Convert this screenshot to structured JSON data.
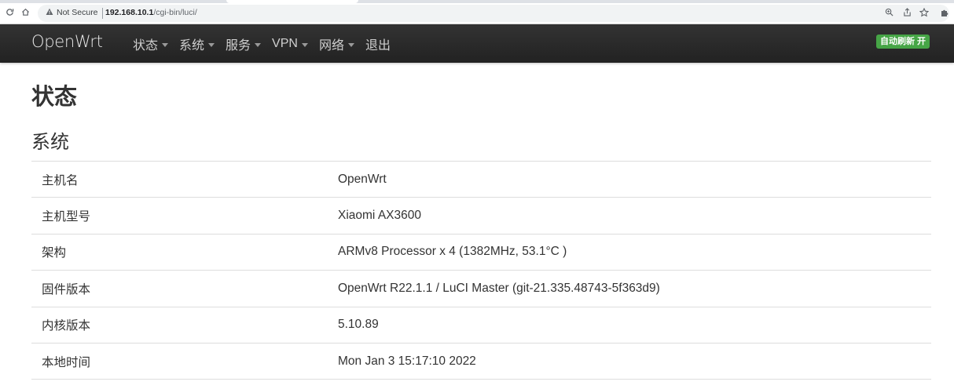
{
  "browser": {
    "security_label": "Not Secure",
    "url_host": "192.168.10.1",
    "url_path": "/cgi-bin/luci/"
  },
  "navbar": {
    "brand": "OpenWrt",
    "menu": [
      {
        "label": "状态",
        "has_dropdown": true
      },
      {
        "label": "系统",
        "has_dropdown": true
      },
      {
        "label": "服务",
        "has_dropdown": true
      },
      {
        "label": "VPN",
        "has_dropdown": true
      },
      {
        "label": "网络",
        "has_dropdown": true
      },
      {
        "label": "退出",
        "has_dropdown": false
      }
    ],
    "auto_refresh": "自动刷新 开"
  },
  "page": {
    "title": "状态",
    "section_title": "系统",
    "rows": [
      {
        "key": "主机名",
        "value": "OpenWrt"
      },
      {
        "key": "主机型号",
        "value": "Xiaomi AX3600"
      },
      {
        "key": "架构",
        "value": "ARMv8 Processor x 4 (1382MHz, 53.1°C )"
      },
      {
        "key": "固件版本",
        "value": "OpenWrt R22.1.1 / LuCI Master (git-21.335.48743-5f363d9)"
      },
      {
        "key": "内核版本",
        "value": "5.10.89"
      },
      {
        "key": "本地时间",
        "value": "Mon Jan 3 15:17:10 2022"
      }
    ]
  },
  "colors": {
    "navbar_bg": "#222222",
    "refresh_badge": "#46a546"
  }
}
